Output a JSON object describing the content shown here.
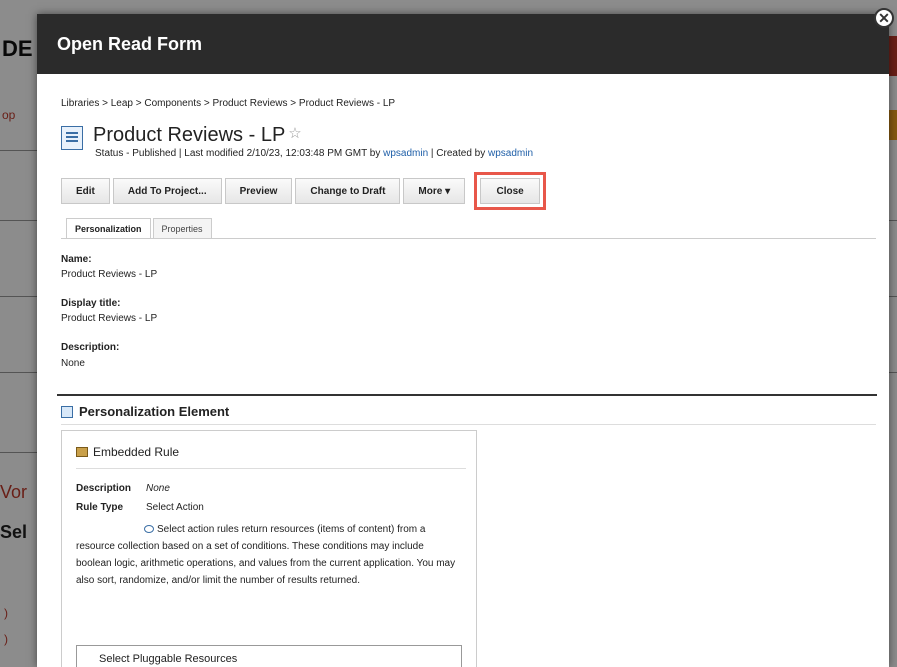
{
  "background": {
    "fragments": [
      "DE",
      "op",
      "Vor",
      "Sel",
      ")",
      ")"
    ]
  },
  "modal": {
    "title": "Open Read Form",
    "close_symbol": "✕"
  },
  "breadcrumb": "Libraries > Leap > Components > Product Reviews > Product Reviews - LP",
  "document": {
    "title": "Product Reviews - LP",
    "star": "☆",
    "status_prefix": "Status - Published | Last modified 2/10/23, 12:03:48 PM GMT by ",
    "modified_by": "wpsadmin",
    "created_prefix": " | Created by ",
    "created_by": "wpsadmin"
  },
  "toolbar": {
    "edit": "Edit",
    "add_to_project": "Add To Project...",
    "preview": "Preview",
    "change_to_draft": "Change to Draft",
    "more": "More ▾",
    "close": "Close"
  },
  "tabs": {
    "personalization": "Personalization",
    "properties": "Properties"
  },
  "fields": {
    "name_label": "Name:",
    "name_value": "Product Reviews - LP",
    "display_title_label": "Display title:",
    "display_title_value": "Product Reviews - LP",
    "description_label": "Description:",
    "description_value": "None"
  },
  "section": {
    "title": "Personalization Element"
  },
  "rule": {
    "heading": "Embedded Rule",
    "description_label": "Description",
    "description_value": "None",
    "rule_type_label": "Rule Type",
    "rule_type_value": "Select Action",
    "explanation": "Select action rules return resources (items of content) from a resource collection based on a set of conditions. These conditions may include boolean logic, arithmetic operations, and values from the current application. You may also sort, randomize, and/or limit the number of results returned.",
    "resource": "Select Pluggable Resources"
  },
  "colors": {
    "header_bg": "#2b2b2b",
    "link": "#1f5fa8",
    "highlight": "#e8574a"
  }
}
